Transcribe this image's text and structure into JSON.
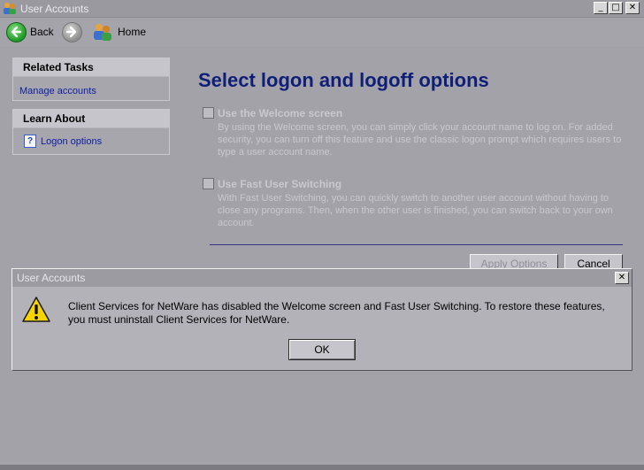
{
  "window": {
    "title": "User Accounts",
    "controls": {
      "minimize": "_",
      "maximize": "□",
      "close": "✕"
    }
  },
  "toolbar": {
    "back_label": "Back",
    "home_label": "Home"
  },
  "sidebar": {
    "related_tasks": {
      "header": "Related Tasks",
      "items": [
        {
          "label": "Manage accounts"
        }
      ]
    },
    "learn_about": {
      "header": "Learn About",
      "items": [
        {
          "label": "Logon options",
          "icon": "help-icon"
        }
      ]
    }
  },
  "main": {
    "title": "Select logon and logoff options",
    "options": [
      {
        "label": "Use the Welcome screen",
        "checked": false,
        "description": "By using the Welcome screen, you can simply click your account name to log on. For added security, you can turn off this feature and use the classic logon prompt which requires users to type a user account name."
      },
      {
        "label": "Use Fast User Switching",
        "checked": false,
        "description": "With Fast User Switching, you can quickly switch to another user account without having to close any programs. Then, when the other user is finished, you can switch back to your own account."
      }
    ],
    "apply_label": "Apply Options",
    "cancel_label": "Cancel"
  },
  "dialog": {
    "title": "User Accounts",
    "close": "✕",
    "message": "Client Services for NetWare has disabled the Welcome screen and Fast User Switching. To restore these features, you must uninstall Client Services for NetWare.",
    "ok_label": "OK",
    "icon": "warning-icon"
  },
  "colors": {
    "title_blue": "#0f1f78",
    "link_blue": "#0c1ea0",
    "separator": "#33338a"
  }
}
